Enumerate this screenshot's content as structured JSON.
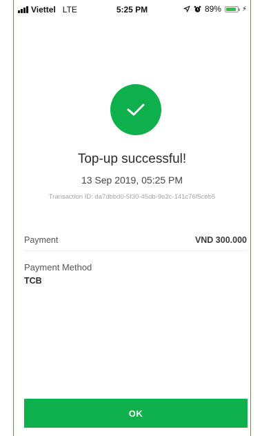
{
  "status_bar": {
    "carrier": "Viettel",
    "network": "LTE",
    "time": "5:25 PM",
    "battery_text": "89%",
    "battery_level": 0.89,
    "icons": [
      "signal-icon",
      "location-arrow-icon",
      "alarm-icon",
      "battery-icon",
      "charging-bolt-icon"
    ]
  },
  "result": {
    "title": "Top-up successful!",
    "date": "13 Sep 2019, 05:25 PM",
    "transaction_id": "Transaction ID: da7dbbd0-5f30-45db-9e2c-141c76f5ceb5",
    "icon": "checkmark-icon",
    "accent_color": "#0eb04b"
  },
  "details": {
    "payment_label": "Payment",
    "payment_value": "VND 300.000",
    "method_label": "Payment Method",
    "method_value": "TCB"
  },
  "actions": {
    "ok_label": "OK"
  }
}
